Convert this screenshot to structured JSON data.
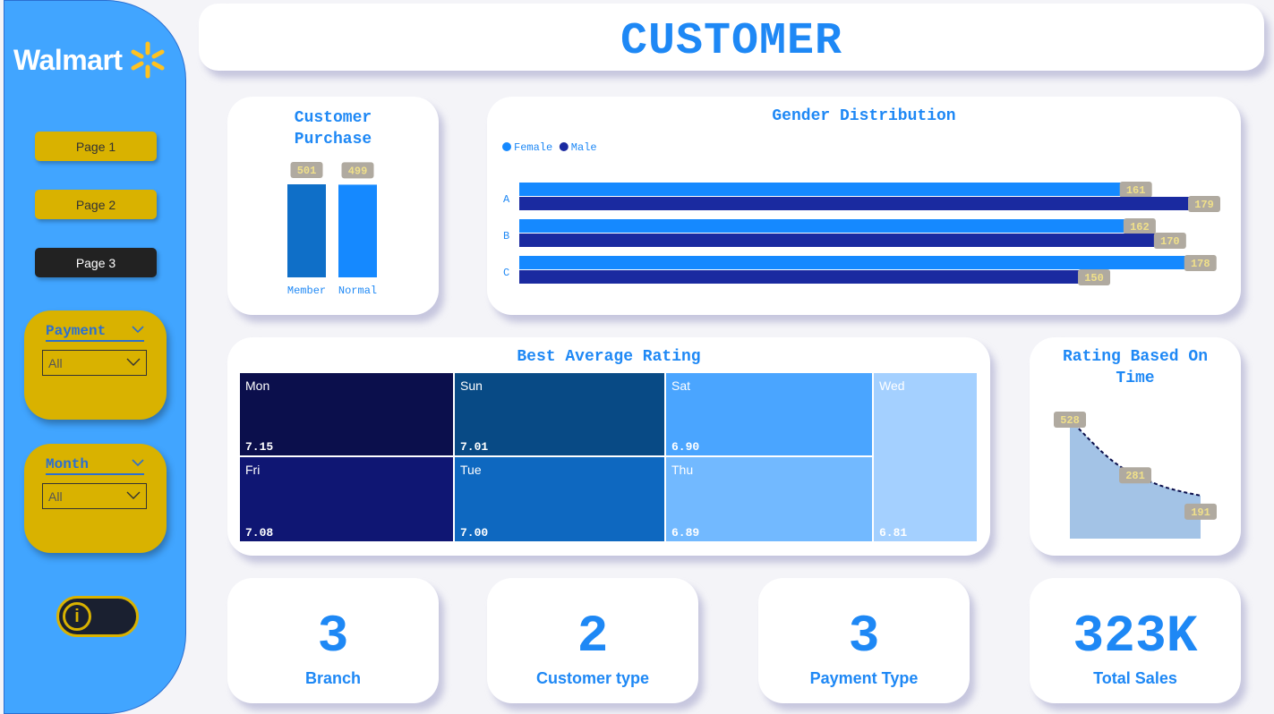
{
  "sidebar": {
    "logo_text": "Walmart",
    "pages": [
      "Page 1",
      "Page 2",
      "Page 3"
    ],
    "active_page": "Page 3",
    "slicers": [
      {
        "title": "Payment",
        "value": "All"
      },
      {
        "title": "Month",
        "value": "All"
      }
    ],
    "toggle_icon": "info-icon"
  },
  "header": {
    "title": "CUSTOMER"
  },
  "customer_purchase": {
    "title_line1": "Customer",
    "title_line2": "Purchase"
  },
  "gender_distribution": {
    "title": "Gender Distribution",
    "legend": [
      "Female",
      "Male"
    ]
  },
  "best_rating": {
    "title": "Best Average Rating"
  },
  "rating_time": {
    "title_line1": "Rating Based On",
    "title_line2": "Time"
  },
  "kpis": [
    {
      "value": "3",
      "label": "Branch"
    },
    {
      "value": "2",
      "label": "Customer type"
    },
    {
      "value": "3",
      "label": "Payment Type"
    },
    {
      "value": "323K",
      "label": "Total Sales"
    }
  ],
  "colors": {
    "accent": "#1e88f5",
    "sidebar": "#41a5ff",
    "gold": "#d9b200",
    "female": "#1589ff",
    "male": "#1a2aa0"
  },
  "chart_data": [
    {
      "type": "bar",
      "title": "Customer Purchase",
      "categories": [
        "Member",
        "Normal"
      ],
      "values": [
        501,
        499
      ],
      "data_labels": [
        "501",
        "499"
      ]
    },
    {
      "type": "bar",
      "orientation": "horizontal",
      "title": "Gender Distribution",
      "categories": [
        "A",
        "B",
        "C"
      ],
      "series": [
        {
          "name": "Female",
          "values": [
            161,
            162,
            178
          ]
        },
        {
          "name": "Male",
          "values": [
            179,
            170,
            150
          ]
        }
      ],
      "legend": "top-left"
    },
    {
      "type": "heatmap",
      "title": "Best Average Rating",
      "tiles": [
        {
          "name": "Mon",
          "value": "7.15"
        },
        {
          "name": "Sun",
          "value": "7.01"
        },
        {
          "name": "Sat",
          "value": "6.90"
        },
        {
          "name": "Wed",
          "value": "6.81"
        },
        {
          "name": "Fri",
          "value": "7.08"
        },
        {
          "name": "Tue",
          "value": "7.00"
        },
        {
          "name": "Thu",
          "value": "6.89"
        }
      ]
    },
    {
      "type": "area",
      "title": "Rating Based On Time",
      "values": [
        528,
        281,
        191
      ],
      "data_labels": [
        "528",
        "281",
        "191"
      ]
    }
  ]
}
